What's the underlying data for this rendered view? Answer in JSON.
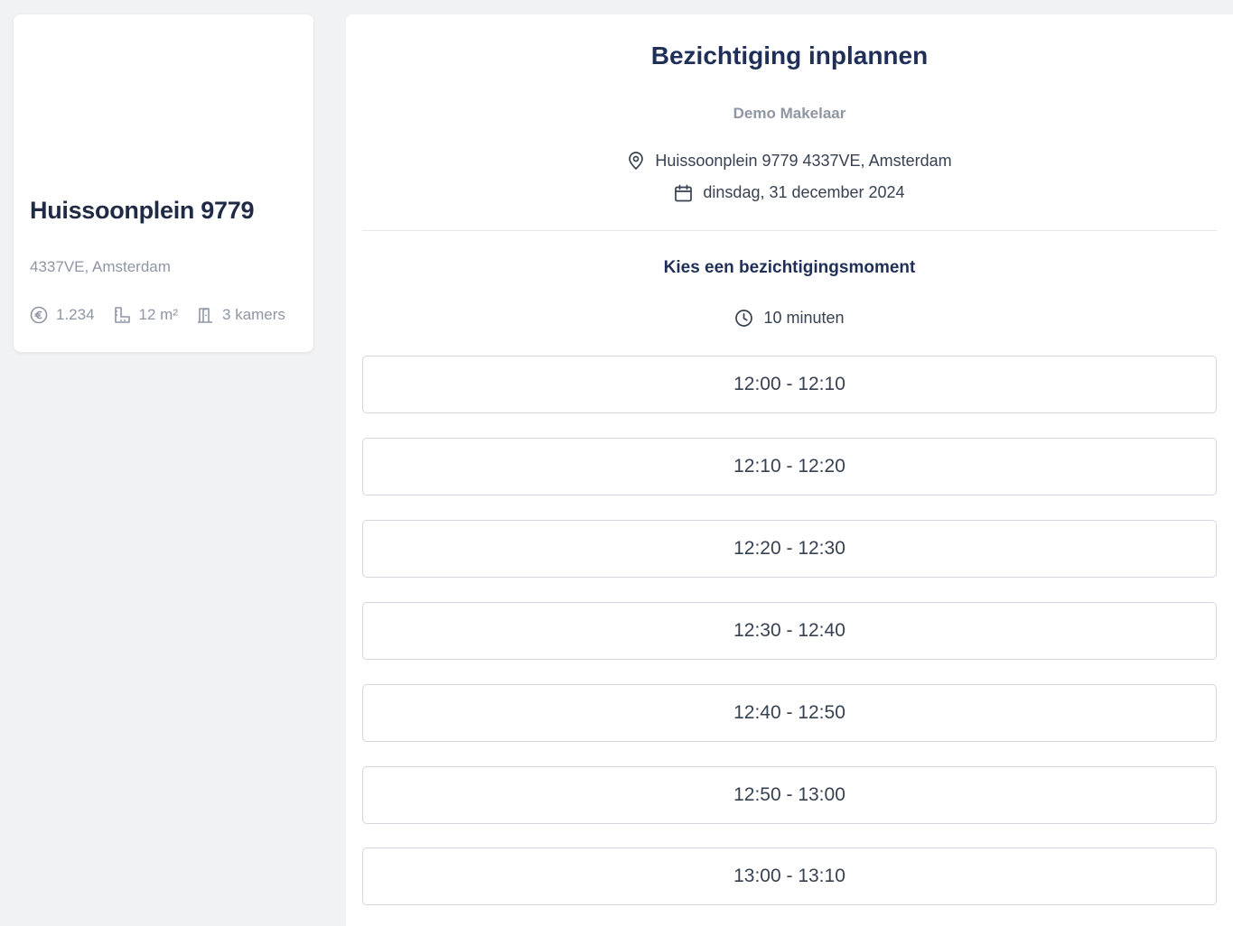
{
  "property": {
    "title": "Huissoonplein 9779",
    "subtitle": "4337VE, Amsterdam",
    "price": "1.234",
    "area": "12 m²",
    "rooms": "3 kamers",
    "icons": [
      "euro-icon",
      "area-icon",
      "door-icon"
    ]
  },
  "booking": {
    "title": "Bezichtiging inplannen",
    "agent": "Demo Makelaar",
    "address": "Huissoonplein 9779 4337VE, Amsterdam",
    "date": "dinsdag, 31 december 2024",
    "choose_label": "Kies een bezichtigingsmoment",
    "duration": "10 minuten",
    "slots": [
      "12:00 - 12:10",
      "12:10 - 12:20",
      "12:20 - 12:30",
      "12:30 - 12:40",
      "12:40 - 12:50",
      "12:50 - 13:00",
      "13:00 - 13:10"
    ]
  },
  "colors": {
    "background": "#f1f2f4",
    "title": "#1f2f58",
    "muted": "#8f96a3",
    "border": "#d4d7dd"
  }
}
